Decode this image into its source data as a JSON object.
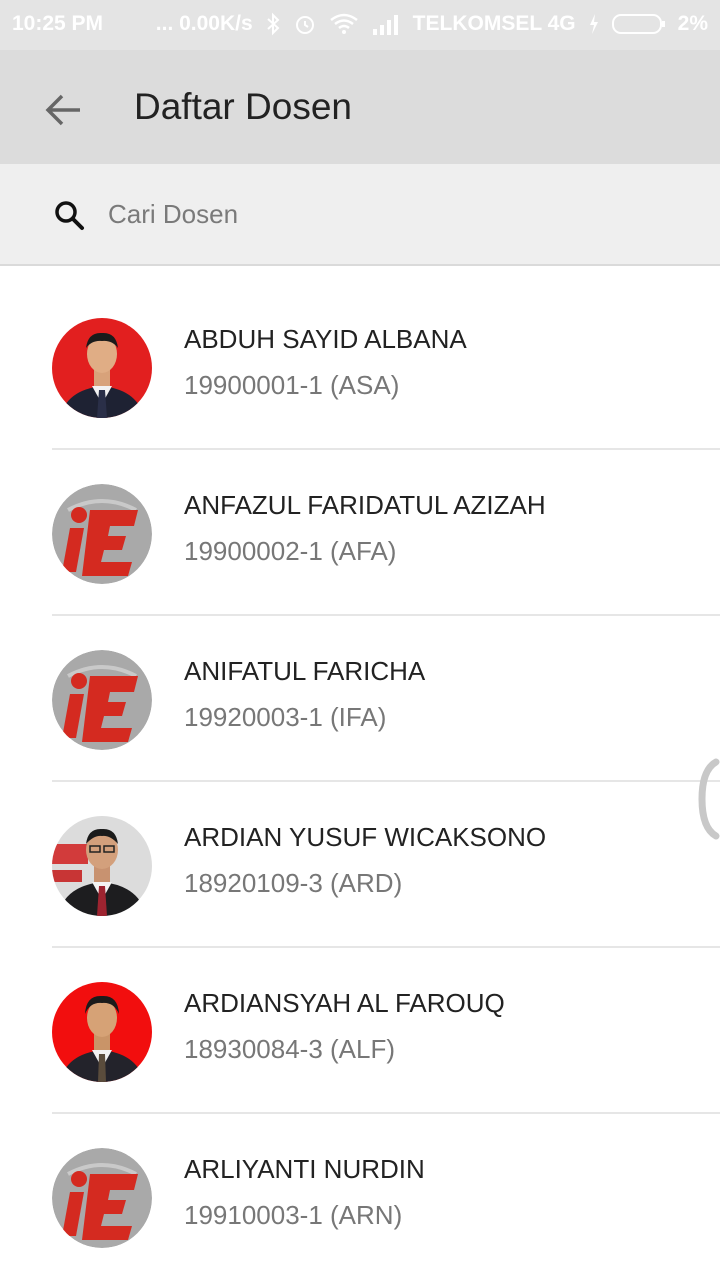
{
  "status_bar": {
    "time": "10:25 PM",
    "net_speed": "... 0.00K/s",
    "carrier": "TELKOMSEL 4G",
    "battery": "2%"
  },
  "header": {
    "title": "Daftar Dosen"
  },
  "search": {
    "placeholder": "Cari Dosen",
    "value": ""
  },
  "lecturers": [
    {
      "name": "ABDUH SAYID ALBANA",
      "id": "19900001-1 (ASA)",
      "avatar": "photo-red"
    },
    {
      "name": "ANFAZUL FARIDATUL AZIZAH",
      "id": "19900002-1 (AFA)",
      "avatar": "logo-icon"
    },
    {
      "name": "ANIFATUL FARICHA",
      "id": "19920003-1 (IFA)",
      "avatar": "logo-icon"
    },
    {
      "name": "ARDIAN YUSUF WICAKSONO",
      "id": "18920109-3 (ARD)",
      "avatar": "photo-gray"
    },
    {
      "name": "ARDIANSYAH AL FAROUQ",
      "id": "18930084-3 (ALF)",
      "avatar": "photo-red"
    },
    {
      "name": "ARLIYANTI NURDIN",
      "id": "19910003-1 (ARN)",
      "avatar": "logo-icon"
    }
  ],
  "colors": {
    "app_bar": "#dcdcdc",
    "search_bar": "#efefef",
    "logo_red": "#d42a20",
    "logo_gray": "#a9a9a9"
  }
}
